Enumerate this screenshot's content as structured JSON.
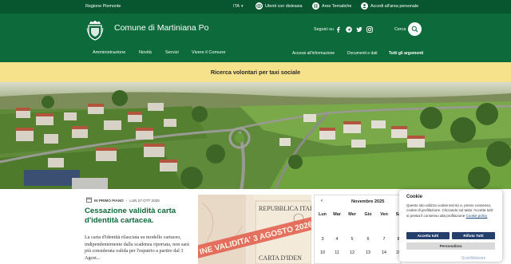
{
  "topbar": {
    "region": "Regione Piemonte",
    "language": "ITA",
    "links": [
      {
        "label": "Utenti con dislessia",
        "icon": "eye-icon"
      },
      {
        "label": "Aree Tematiche",
        "icon": "grid-icon"
      },
      {
        "label": "Accedi all'area personale",
        "icon": "user-icon"
      }
    ]
  },
  "header": {
    "title": "Comune di Martiniana Po",
    "follow_label": "Seguici su",
    "social": [
      "facebook-icon",
      "telegram-icon",
      "twitter-icon",
      "instagram-icon"
    ],
    "search_label": "Cerca"
  },
  "nav": {
    "primary": [
      "Amministrazione",
      "Novità",
      "Servizi",
      "Vivere il Comune"
    ],
    "secondary": [
      "Accessi all'informazione",
      "Documenti e dati",
      "Tutti gli argomenti"
    ]
  },
  "banner": {
    "text": "Ricerca volontari per taxi sociale"
  },
  "article": {
    "category": "IN PRIMO PIANO",
    "date": "LUN 27 OTT 2025",
    "title": "Cessazione validità carta d'identità cartacea.",
    "body": "La carta d'identità rilasciata su modello cartaceo, indipendentemente dalla scadenza riportata, non sarà più considerata valida per l'espatrio a partire dal 3 Agost..."
  },
  "photo_text": {
    "stamp": "INE VALIDITA' 3 AGOSTO 2026",
    "header": "REPUBBLICA ITALIANA",
    "card": "CARTA D'IDEN"
  },
  "calendar": {
    "month": "Novembre 2025",
    "days": [
      "Lun",
      "Mar",
      "Mer",
      "Gio",
      "Ven",
      "Sa"
    ],
    "week1": [
      "3",
      "4",
      "5",
      "6",
      "7",
      "8"
    ],
    "week2": [
      "10",
      "11",
      "12",
      "13",
      "14",
      "15"
    ]
  },
  "cookie": {
    "title": "Cookie",
    "text_main": "Questo sito utilizza cookie tecnici e, previo consenso, cookie di profilazione. Cliccando sul tasto 'Accetta tutti' si presta il consenso alla profilazione ",
    "text_link": "Cookie policy",
    "accept": "Accetta tutti",
    "reject": "Rifiuta Tutti",
    "customize": "Personalizza"
  },
  "watermark": "ScanMalware",
  "colors": {
    "header_green": "#0d6a3a",
    "topbar_green": "#08562f",
    "banner_yellow": "#f5e28a",
    "button_navy": "#243f6b"
  }
}
